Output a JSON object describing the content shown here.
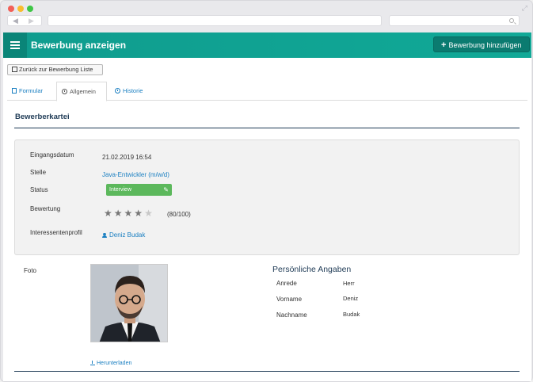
{
  "header": {
    "title": "Bewerbung anzeigen",
    "add_button": "Bewerbung hinzufügen"
  },
  "back_button": "Zurück zur Bewerbung Liste",
  "tabs": [
    {
      "label": "Formular",
      "active": false
    },
    {
      "label": "Allgemein",
      "active": true
    },
    {
      "label": "Historie",
      "active": false
    }
  ],
  "section_title": "Bewerberkartei",
  "info": {
    "eingangsdatum_label": "Eingangsdatum",
    "eingangsdatum_value": "21.02.2019 16:54",
    "stelle_label": "Stelle",
    "stelle_value": "Java-Entwickler (m/w/d)",
    "status_label": "Status",
    "status_value": "Interview",
    "bewertung_label": "Bewertung",
    "bewertung_stars_filled": 4,
    "bewertung_stars_total": 5,
    "bewertung_score": "(80/100)",
    "profil_label": "Interessentenprofil",
    "profil_value": "Deniz Budak"
  },
  "foto": {
    "label": "Foto",
    "download": "Herunterladen"
  },
  "personal": {
    "title": "Persönliche Angaben",
    "anrede_label": "Anrede",
    "anrede_value": "Herr",
    "vorname_label": "Vorname",
    "vorname_value": "Deniz",
    "nachname_label": "Nachname",
    "nachname_value": "Budak"
  },
  "colors": {
    "header_bg": "#11a997",
    "status_badge": "#5cb85c",
    "link": "#1a7fc1",
    "section_rule": "#1e3a55"
  }
}
